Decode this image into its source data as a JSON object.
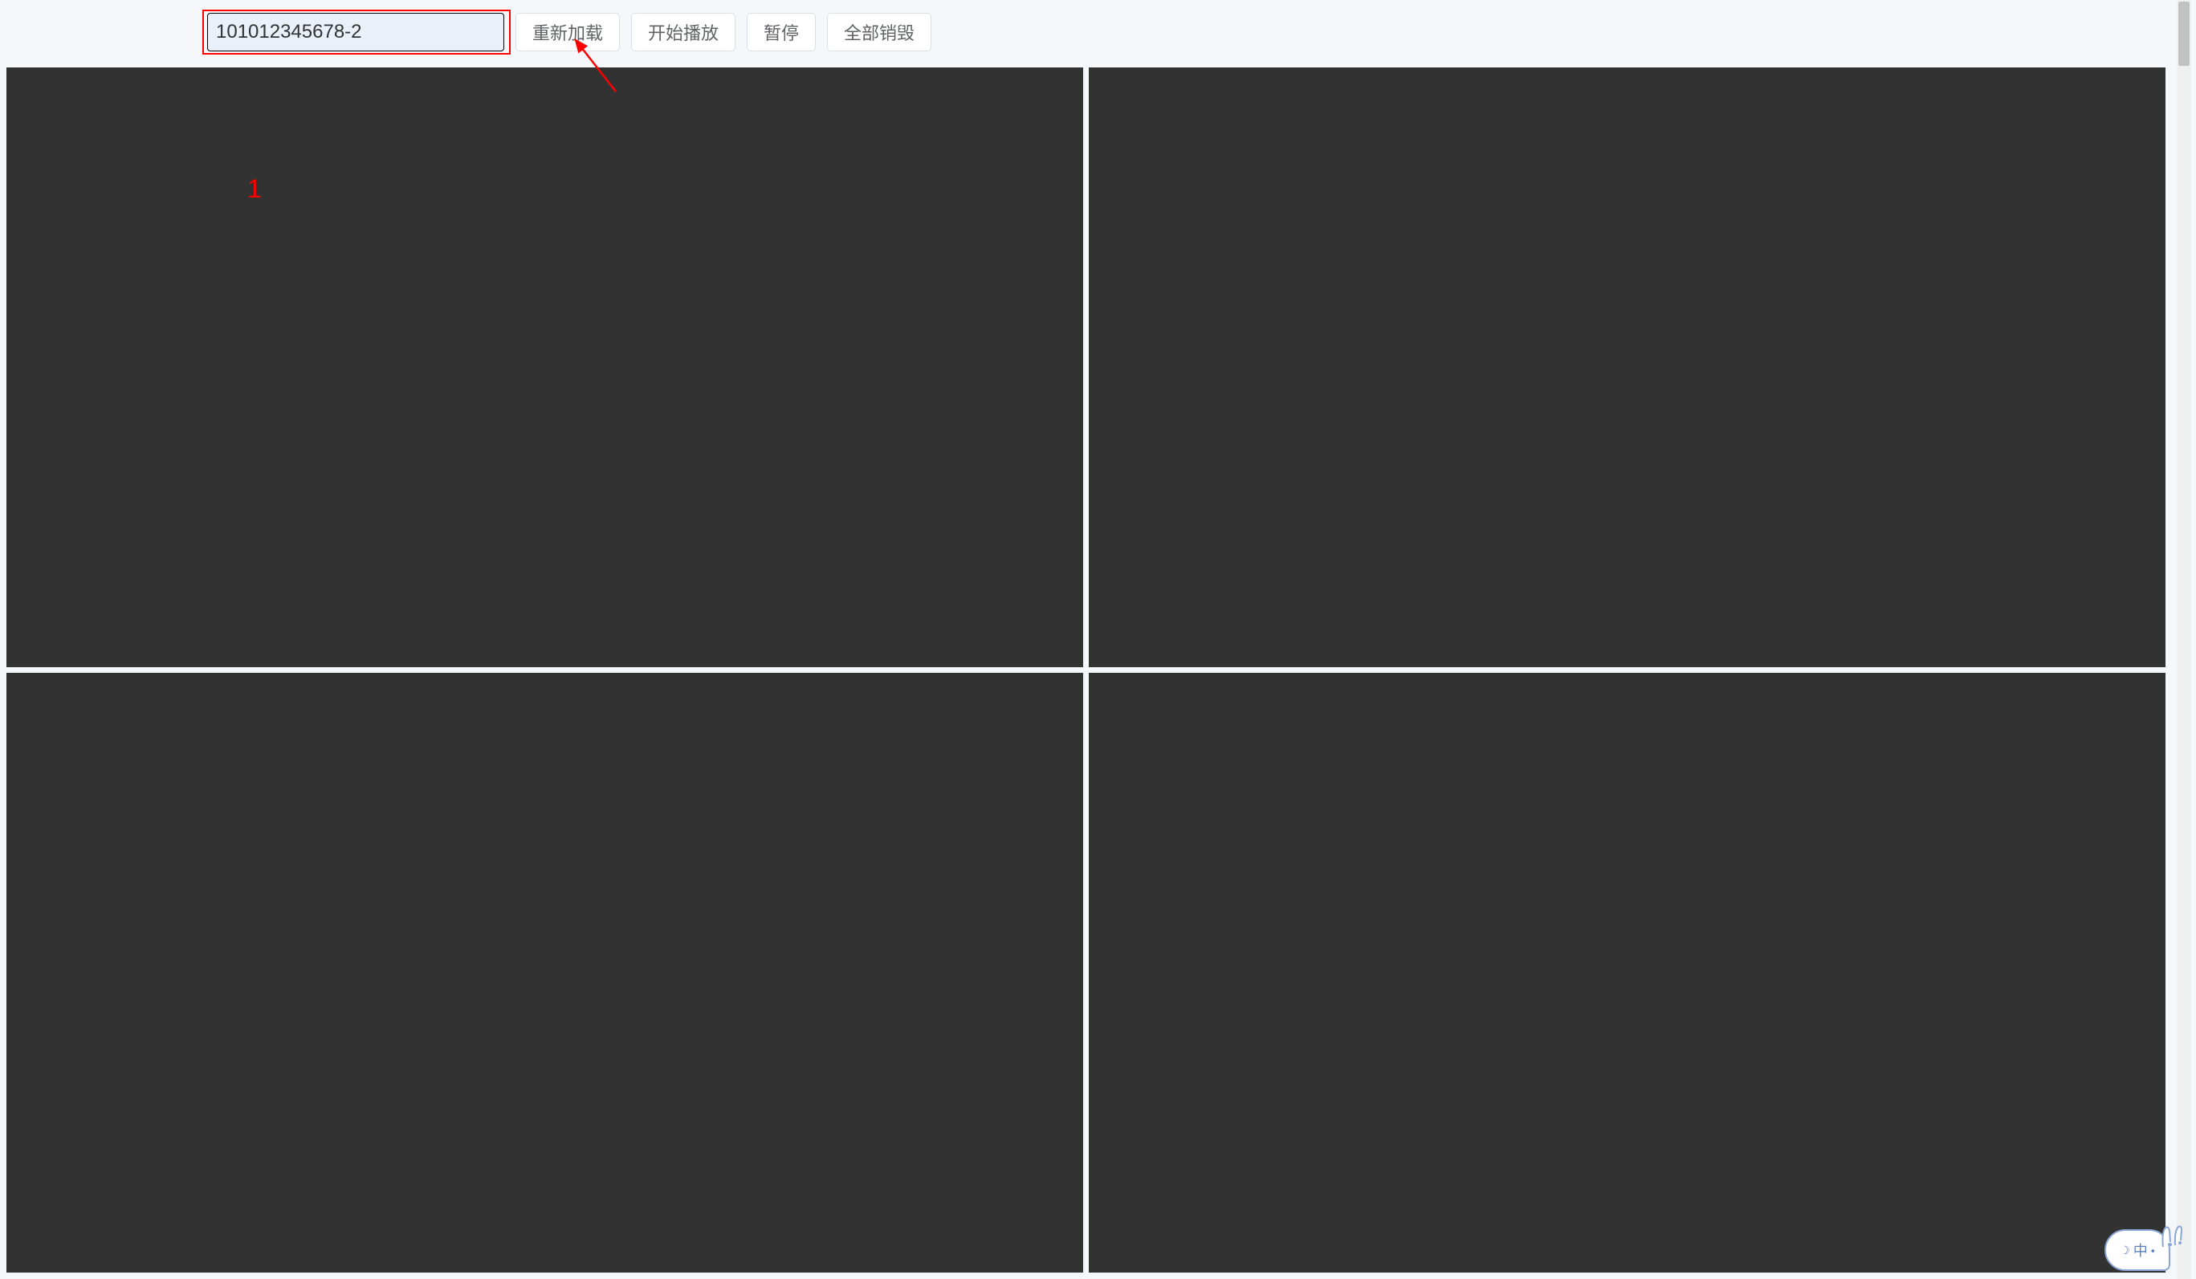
{
  "toolbar": {
    "id_value": "101012345678-2",
    "reload_label": "重新加载",
    "play_label": "开始播放",
    "pause_label": "暂停",
    "destroy_all_label": "全部销毁"
  },
  "annotations": {
    "step1": "1"
  },
  "mascot": {
    "char": "中",
    "moon": "☽",
    "small": "⬩"
  }
}
